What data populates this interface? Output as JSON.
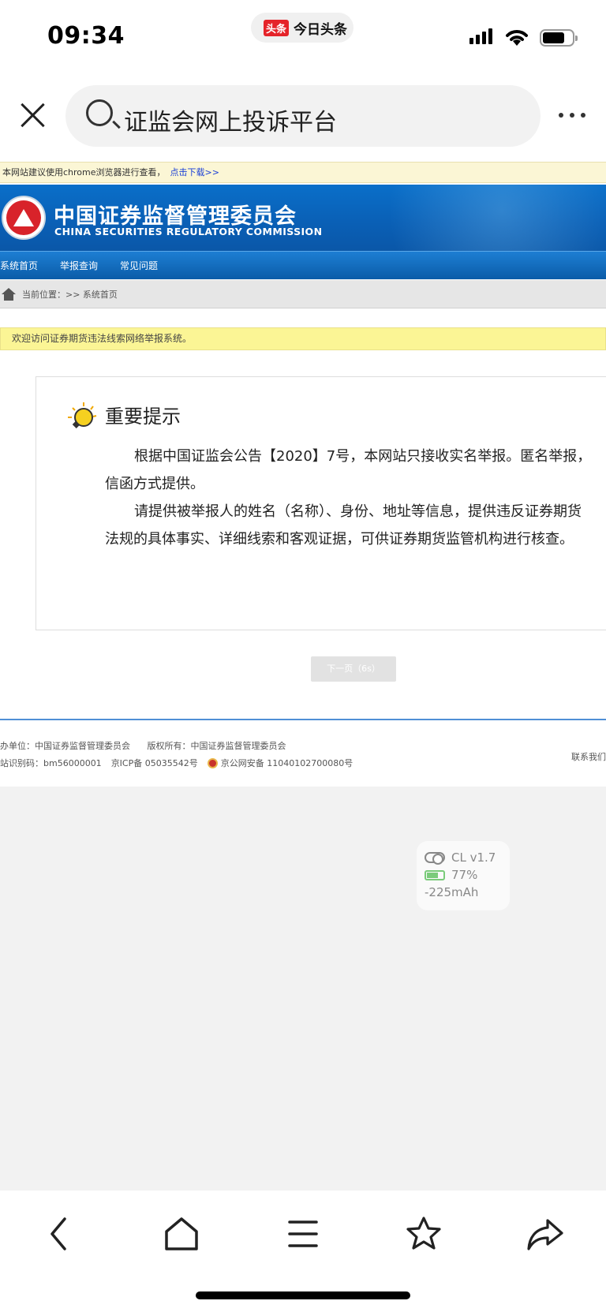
{
  "status_bar": {
    "time": "09:34",
    "app_logo": "头条",
    "app_name": "今日头条"
  },
  "browser": {
    "search_text": "证监会网上投诉平台"
  },
  "site": {
    "browser_notice": "本网站建议使用chrome浏览器进行查看，",
    "download_link": "点击下载>>",
    "org_name_cn": "中国证券监督管理委员会",
    "org_name_en": "CHINA SECURITIES REGULATORY COMMISSION",
    "nav": [
      "系统首页",
      "举报查询",
      "常见问题"
    ],
    "breadcrumb": "当前位置：>> 系统首页",
    "welcome": "欢迎访问证券期货违法线索网络举报系统。",
    "tip": {
      "title": "重要提示",
      "lines": [
        "根据中国证监会公告【2020】7号，本网站只接收实名举报。匿名举报，",
        "信函方式提供。",
        "请提供被举报人的姓名（名称）、身份、地址等信息，提供违反证券期货",
        "法规的具体事实、详细线索和客观证据，可供证券期货监管机构进行核查。"
      ]
    },
    "next_button": "下一页（6s）",
    "footer": {
      "line1_a": "办单位：中国证券监督管理委员会",
      "line1_b": "版权所有：中国证券监督管理委员会",
      "line2_a": "站识别码：bm56000001",
      "line2_b": "京ICP备 05035542号",
      "line2_c": "京公网安备 11040102700080号",
      "contact": "联系我们"
    }
  },
  "overlay": {
    "version": "CL v1.7",
    "battery": "77%",
    "current": "-225mAh"
  },
  "colors": {
    "banner_blue": "#0a62b8",
    "nav_blue": "#0b5ca8",
    "welcome_yellow": "#fbf595",
    "notice_yellow": "#fbf6d5",
    "logo_red": "#d8232a"
  },
  "icons": [
    "close-icon",
    "search-icon",
    "more-icon",
    "home-icon",
    "bulb-icon",
    "back-icon",
    "home-nav-icon",
    "menu-icon",
    "star-icon",
    "share-icon"
  ]
}
